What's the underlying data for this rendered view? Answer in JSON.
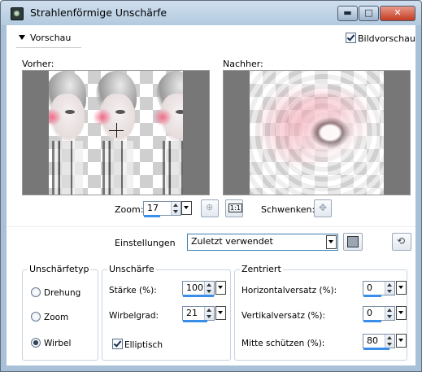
{
  "window": {
    "title": "Strahlenförmige Unschärfe",
    "minimize_glyph": "▬",
    "maximize_glyph": "□",
    "close_glyph": "✕"
  },
  "preview": {
    "toggle_label": "Vorschau",
    "bildvorschau_label": "Bildvorschau",
    "bildvorschau_checked": true,
    "before_label": "Vorher:",
    "after_label": "Nachher:"
  },
  "zoom": {
    "label": "Zoom:",
    "value": "17",
    "one_to_one": "1:1",
    "pan_label": "Schwenken:"
  },
  "settings": {
    "label": "Einstellungen",
    "selected": "Zuletzt verwendet"
  },
  "blur_type": {
    "title": "Unschärfetyp",
    "options": [
      "Drehung",
      "Zoom",
      "Wirbel"
    ],
    "selected": "Wirbel"
  },
  "blur": {
    "title": "Unschärfe",
    "strength_label": "Stärke (%):",
    "strength_value": "100",
    "swirl_label": "Wirbelgrad:",
    "swirl_value": "21",
    "elliptic_label": "Elliptisch",
    "elliptic_checked": true
  },
  "center": {
    "title": "Zentriert",
    "h_offset_label": "Horizontalversatz (%):",
    "h_offset_value": "0",
    "v_offset_label": "Vertikalversatz (%):",
    "v_offset_value": "0",
    "protect_label": "Mitte schützen (%):",
    "protect_value": "80"
  },
  "colors": {
    "titlebar": "#b3cadf",
    "accent": "#3b8ee8",
    "close": "#c43b21"
  }
}
